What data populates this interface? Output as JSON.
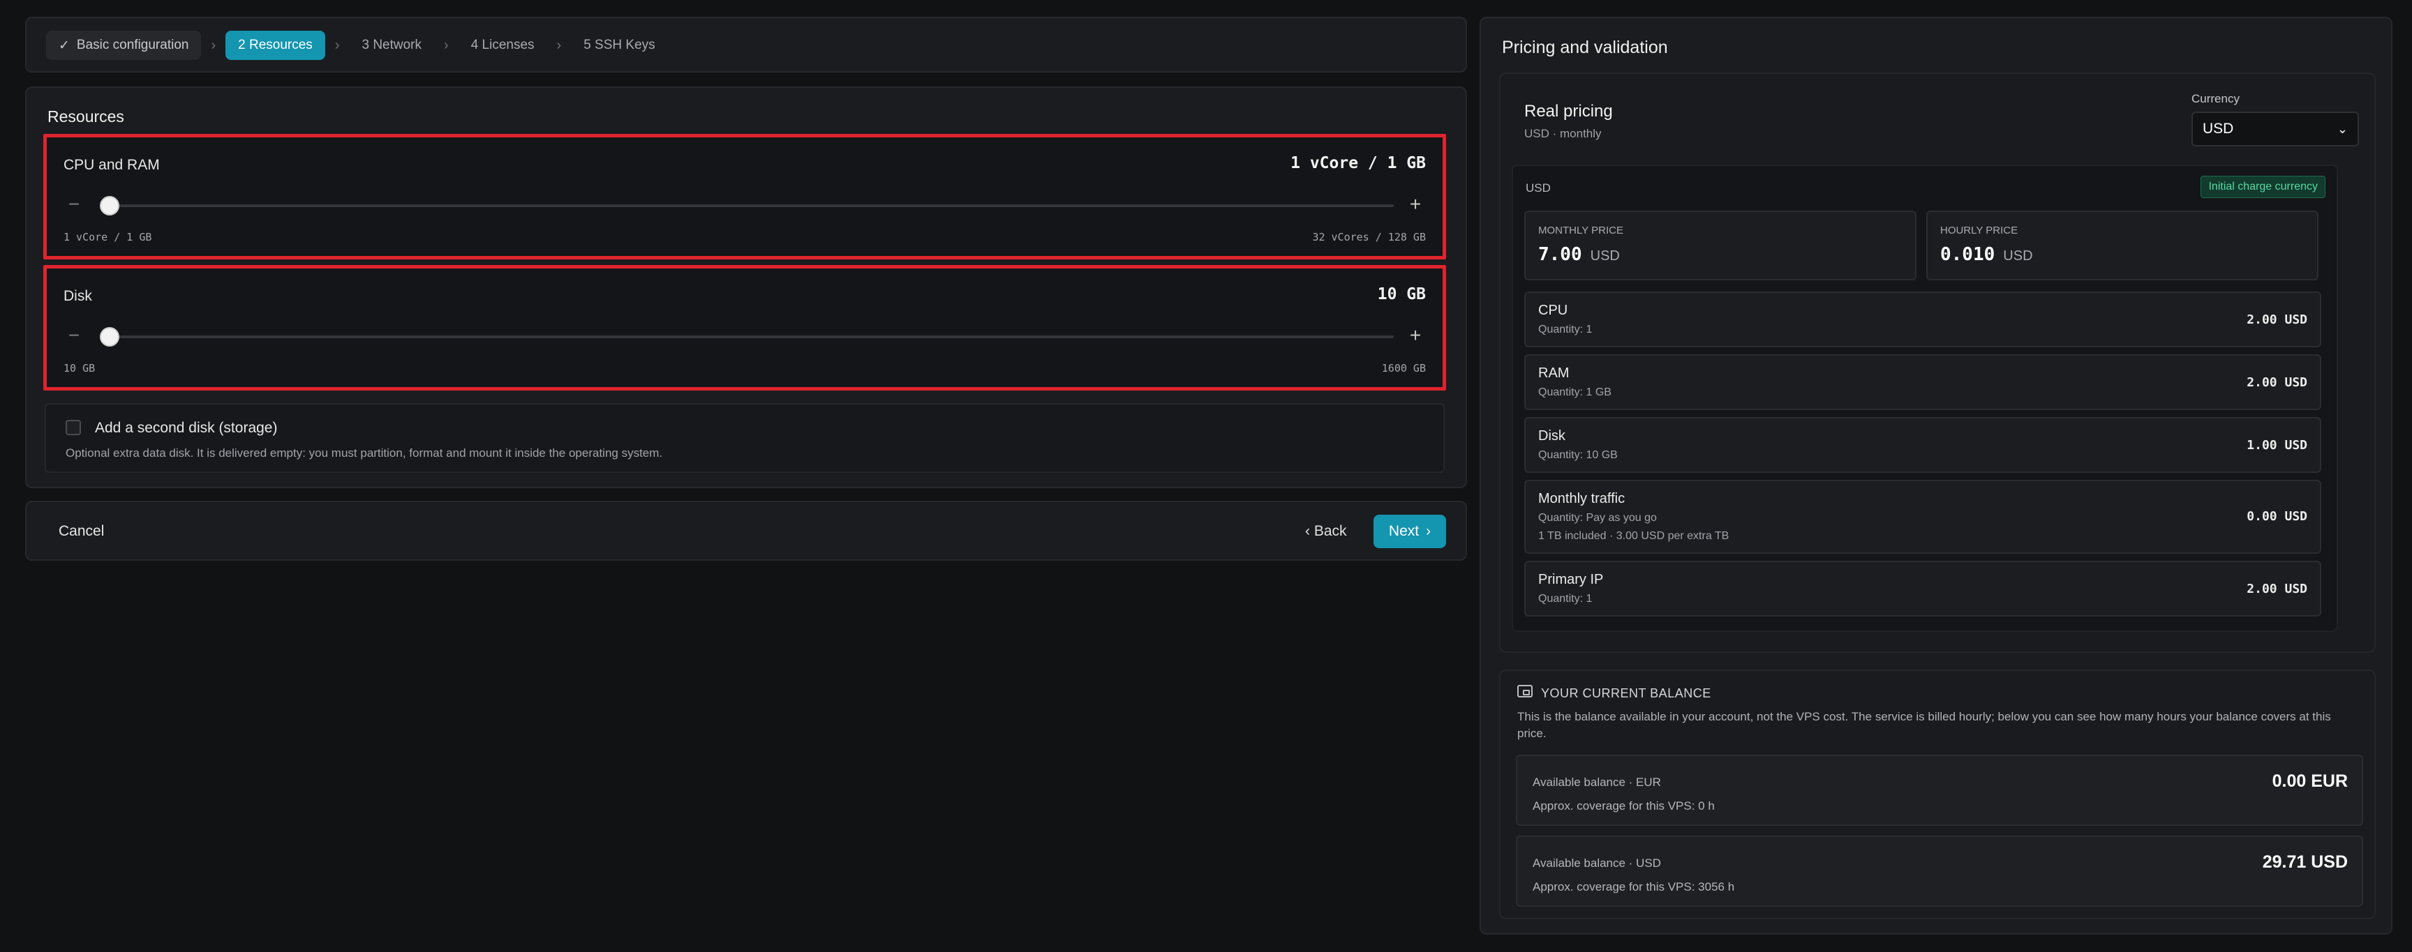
{
  "stepper": {
    "steps": [
      {
        "label": "Basic configuration",
        "state": "done"
      },
      {
        "label": "2  Resources",
        "state": "active"
      },
      {
        "label": "3  Network",
        "state": "pending"
      },
      {
        "label": "4  Licenses",
        "state": "pending"
      },
      {
        "label": "5  SSH Keys",
        "state": "pending"
      }
    ]
  },
  "resources": {
    "title": "Resources",
    "cpu_ram": {
      "label": "CPU and RAM",
      "value": "1 vCore / 1 GB",
      "min": "1 vCore / 1 GB",
      "max": "32 vCores / 128 GB",
      "level": 0
    },
    "disk": {
      "label": "Disk",
      "value": "10 GB",
      "min": "10 GB",
      "max": "1600 GB",
      "level": 0
    },
    "second_disk": {
      "label": "Add a second disk (storage)",
      "checked": false,
      "help": "Optional extra data disk. It is delivered empty: you must partition, format and mount it inside the operating system."
    }
  },
  "actions": {
    "cancel": "Cancel",
    "back": "Back",
    "next": "Next"
  },
  "pricing": {
    "title": "Pricing and validation",
    "real_title": "Real pricing",
    "real_sub": "USD · monthly",
    "currency_label": "Currency",
    "currency_value": "USD",
    "usd_head": "USD",
    "badge": "Initial charge currency",
    "monthly": {
      "label": "MONTHLY PRICE",
      "value": "7.00",
      "unit": "USD"
    },
    "hourly": {
      "label": "HOURLY PRICE",
      "value": "0.010",
      "unit": "USD"
    },
    "items": [
      {
        "name": "CPU",
        "qty": "Quantity: 1",
        "price": "2.00 USD"
      },
      {
        "name": "RAM",
        "qty": "Quantity: 1 GB",
        "price": "2.00 USD"
      },
      {
        "name": "Disk",
        "qty": "Quantity: 10 GB",
        "price": "1.00 USD"
      },
      {
        "name": "Monthly traffic",
        "qty": "Quantity: Pay as you go",
        "extra": "1 TB included · 3.00 USD per extra TB",
        "price": "0.00 USD"
      },
      {
        "name": "Primary IP",
        "qty": "Quantity: 1",
        "price": "2.00 USD"
      }
    ]
  },
  "balance": {
    "title": "YOUR CURRENT BALANCE",
    "desc": "This is the balance available in your account, not the VPS cost. The service is billed hourly; below you can see how many hours your balance covers at this price.",
    "cards": [
      {
        "label": "Available balance · EUR",
        "coverage": "Approx. coverage for this VPS: 0 h",
        "amount": "0.00 EUR"
      },
      {
        "label": "Available balance · USD",
        "coverage": "Approx. coverage for this VPS: 3056 h",
        "amount": "29.71 USD"
      }
    ]
  }
}
